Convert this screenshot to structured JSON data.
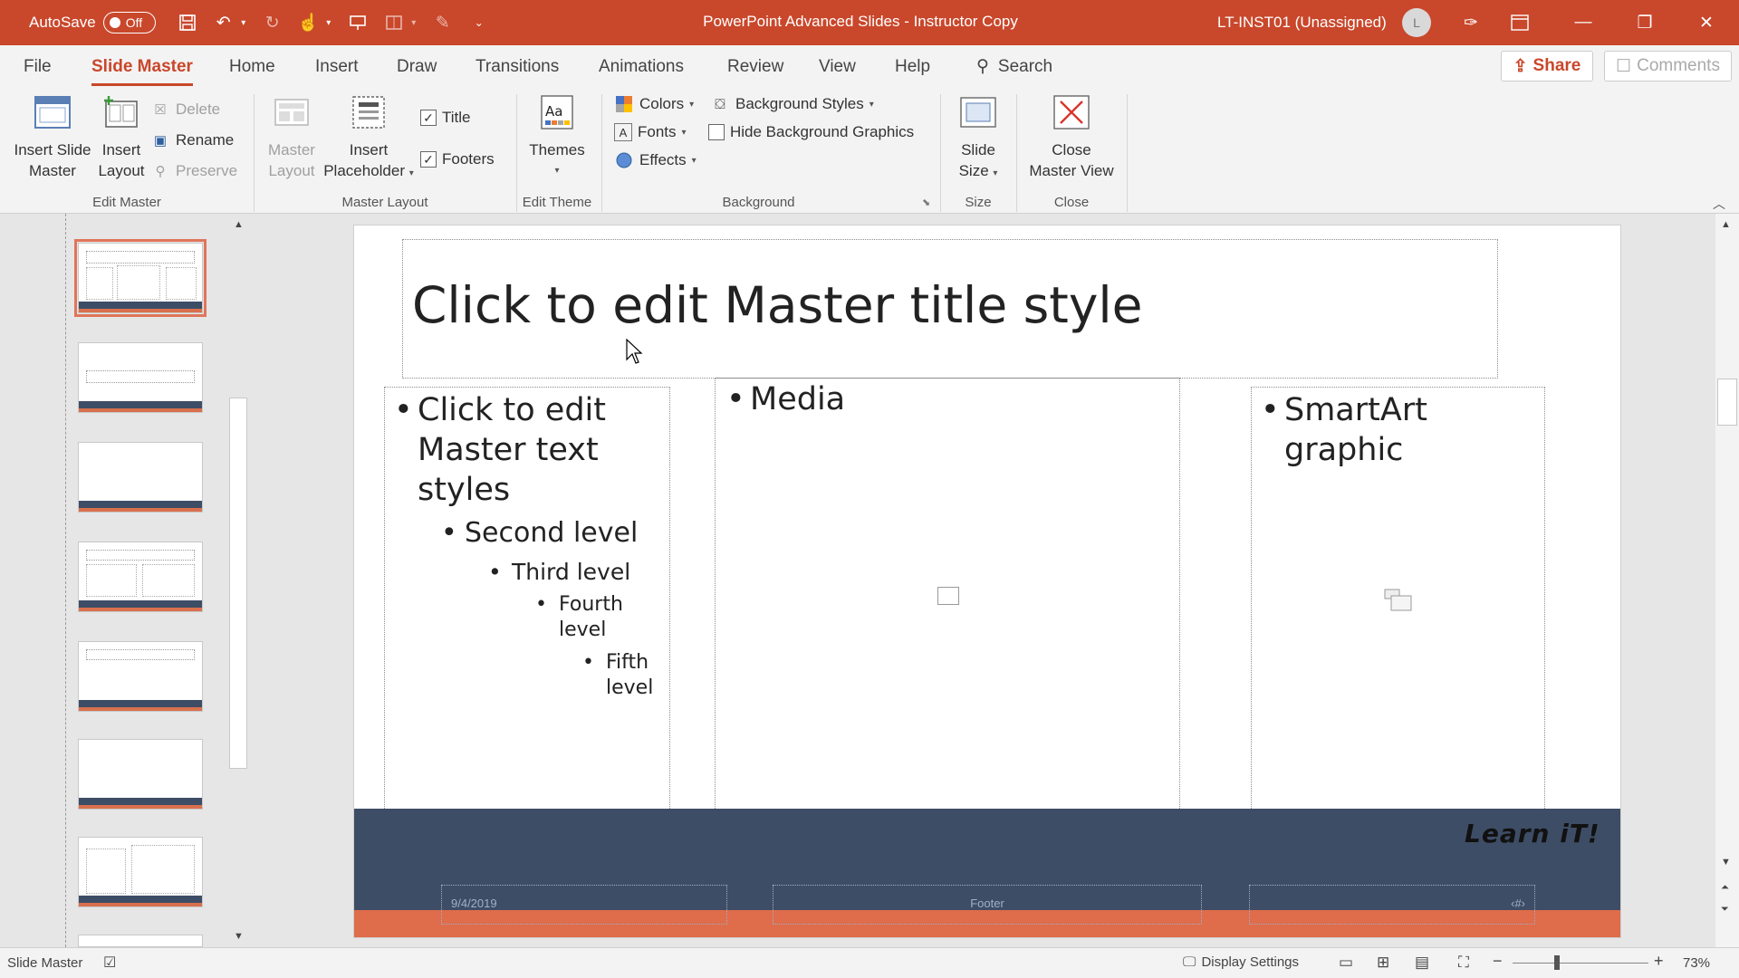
{
  "window": {
    "autosave_label": "AutoSave",
    "autosave_state": "Off",
    "title": "PowerPoint Advanced Slides - Instructor Copy",
    "user": "LT-INST01 (Unassigned)",
    "avatar_initial": "L"
  },
  "tabs": [
    "File",
    "Slide Master",
    "Home",
    "Insert",
    "Draw",
    "Transitions",
    "Animations",
    "Review",
    "View",
    "Help"
  ],
  "active_tab": "Slide Master",
  "search_label": "Search",
  "share_label": "Share",
  "comments_label": "Comments",
  "ribbon": {
    "edit_master": {
      "label": "Edit Master",
      "insert_slide_master": [
        "Insert Slide",
        "Master"
      ],
      "insert_layout": [
        "Insert",
        "Layout"
      ],
      "delete": "Delete",
      "rename": "Rename",
      "preserve": "Preserve"
    },
    "master_layout": {
      "label": "Master Layout",
      "master_layout_btn": [
        "Master",
        "Layout"
      ],
      "insert_placeholder": [
        "Insert",
        "Placeholder"
      ],
      "title_cb": "Title",
      "footers_cb": "Footers"
    },
    "edit_theme": {
      "label": "Edit Theme",
      "themes": "Themes"
    },
    "background": {
      "label": "Background",
      "colors": "Colors",
      "fonts": "Fonts",
      "effects": "Effects",
      "background_styles": "Background Styles",
      "hide_bg": "Hide Background Graphics"
    },
    "size": {
      "label": "Size",
      "slide_size": [
        "Slide",
        "Size"
      ]
    },
    "close": {
      "label": "Close",
      "close_master_view": [
        "Close",
        "Master View"
      ]
    }
  },
  "slide": {
    "title": "Click to edit Master title style",
    "bullets": [
      {
        "text": "Click to edit Master text styles",
        "lines": [
          "Click to edit",
          "Master text",
          "styles"
        ]
      },
      {
        "text": "Second level"
      },
      {
        "text": "Third level"
      },
      {
        "lines": [
          "Fourth",
          "level"
        ]
      },
      {
        "lines": [
          "Fifth",
          "level"
        ]
      }
    ],
    "media": "Media",
    "smartart": [
      "SmartArt",
      "graphic"
    ],
    "logo": "Learn iT!",
    "footer_date": "9/4/2019",
    "footer_text": "Footer",
    "footer_num": "‹#›"
  },
  "status": {
    "view_name": "Slide Master",
    "display_settings": "Display Settings",
    "zoom": "73%"
  },
  "colors": {
    "accent": "#c9472b",
    "footer_band": "#3e4d66",
    "footer_orange": "#df6c4a"
  }
}
